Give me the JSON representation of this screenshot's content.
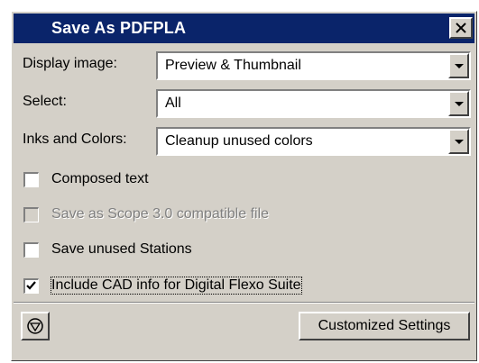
{
  "window": {
    "title": "Save As PDFPLA",
    "close_glyph": "×"
  },
  "fields": [
    {
      "label": "Display image:",
      "value": "Preview & Thumbnail"
    },
    {
      "label": "Select:",
      "value": "All"
    },
    {
      "label": "Inks and Colors:",
      "value": "Cleanup unused colors"
    }
  ],
  "options": [
    {
      "label": "Composed text",
      "checked": false,
      "disabled": false
    },
    {
      "label": "Save as Scope 3.0 compatible file",
      "checked": false,
      "disabled": true
    },
    {
      "label": "Save unused Stations",
      "checked": false,
      "disabled": false
    },
    {
      "label": "Include CAD info for Digital Flexo Suite",
      "checked": true,
      "disabled": false
    }
  ],
  "footer": {
    "left_icon": "circle-triangle-icon",
    "customized_settings_label": "Customized Settings"
  },
  "colors": {
    "titlebar": "#0a246a",
    "dialog": "#d4d0c8"
  }
}
